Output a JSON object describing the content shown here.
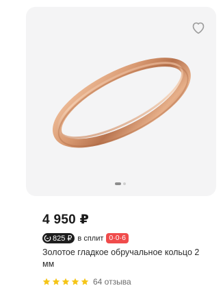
{
  "product": {
    "price": "4 950 ₽",
    "split": {
      "amount": "825 ₽",
      "label": "в сплит",
      "badge": "0·0·6"
    },
    "title": "Золотое гладкое обручальное кольцо 2 мм",
    "rating": {
      "stars": 5,
      "reviews": "64 отзыва"
    },
    "gallery": {
      "current_slide": 1,
      "total_slides": 2
    },
    "icons": {
      "favorite": "heart-icon",
      "split": "split-icon",
      "star": "star-icon"
    },
    "colors": {
      "star": "#f5c518",
      "badge": "#f04b4b",
      "pill": "#1e1e1e",
      "image_bg": "#f4f4f5"
    }
  }
}
